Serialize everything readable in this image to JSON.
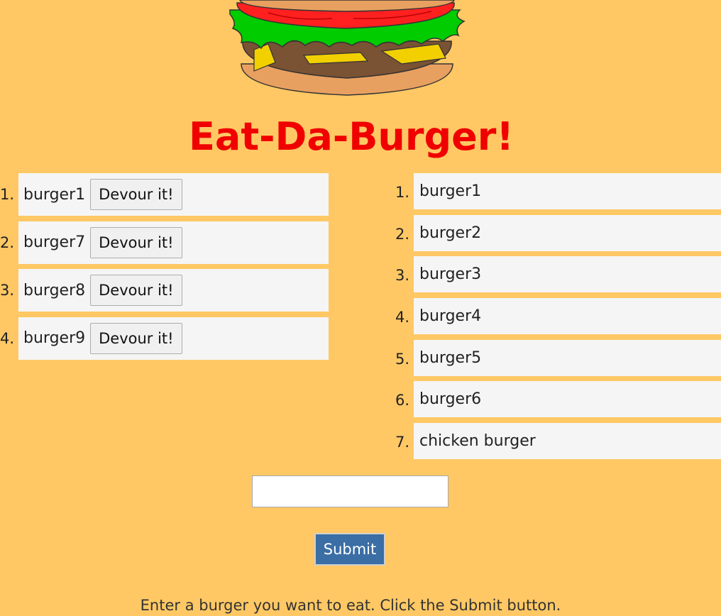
{
  "page": {
    "title": "Eat-Da-Burger!",
    "instructions": "Enter a burger you want to eat. Click the Submit button."
  },
  "uneaten": {
    "items": [
      {
        "num": "1.",
        "name": "burger1",
        "button": "Devour it!"
      },
      {
        "num": "2.",
        "name": "burger7",
        "button": "Devour it!"
      },
      {
        "num": "3.",
        "name": "burger8",
        "button": "Devour it!"
      },
      {
        "num": "4.",
        "name": "burger9",
        "button": "Devour it!"
      }
    ]
  },
  "devoured": {
    "items": [
      {
        "num": "1.",
        "name": "burger1"
      },
      {
        "num": "2.",
        "name": "burger2"
      },
      {
        "num": "3.",
        "name": "burger3"
      },
      {
        "num": "4.",
        "name": "burger4"
      },
      {
        "num": "5.",
        "name": "burger5"
      },
      {
        "num": "6.",
        "name": "burger6"
      },
      {
        "num": "7.",
        "name": "chicken burger"
      }
    ]
  },
  "form": {
    "input_value": "",
    "submit_label": "Submit"
  },
  "colors": {
    "background": "#ffc864",
    "title": "#f00000",
    "submit": "#3a6ea5",
    "item_bg": "#f5f5f5"
  },
  "icons": {
    "logo": "burger-logo"
  }
}
